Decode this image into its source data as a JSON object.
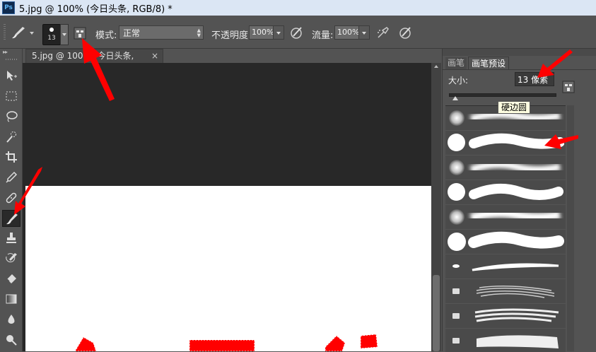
{
  "window": {
    "title": "5.jpg @ 100% (今日头条, RGB/8) *",
    "app_icon": "Ps"
  },
  "options_bar": {
    "brush_size": "13",
    "mode_label": "模式:",
    "mode_value": "正常",
    "opacity_label": "不透明度:",
    "opacity_value": "100%",
    "flow_label": "流量:",
    "flow_value": "100%",
    "icons": [
      "brush-tool-icon",
      "brush-panel-toggle-icon",
      "pressure-opacity-icon",
      "airbrush-icon",
      "pressure-size-icon"
    ]
  },
  "document": {
    "tab_title": "5.jpg @ 100% (今日头条, RGB/8) *",
    "close": "×"
  },
  "toolbar": {
    "collapse": "▸▸",
    "tools": [
      "move-tool-icon",
      "marquee-tool-icon",
      "lasso-tool-icon",
      "quick-selection-tool-icon",
      "crop-tool-icon",
      "eyedropper-tool-icon",
      "healing-brush-tool-icon",
      "brush-tool-icon",
      "clone-stamp-tool-icon",
      "history-brush-tool-icon",
      "eraser-tool-icon",
      "gradient-tool-icon",
      "blur-tool-icon",
      "dodge-tool-icon"
    ],
    "active_tool": "brush-tool-icon"
  },
  "brush_panel": {
    "tab_brush": "画笔",
    "tab_presets": "画笔预设",
    "size_label": "大小:",
    "size_value": "13 像素",
    "tooltip": "硬边圆",
    "size_slider_level": 0.03
  },
  "colors": {
    "accent_red": "#ff0000",
    "panel_bg": "#535353",
    "canvas_bg": "#282828",
    "titlebar_bg": "#dbe6f4"
  }
}
